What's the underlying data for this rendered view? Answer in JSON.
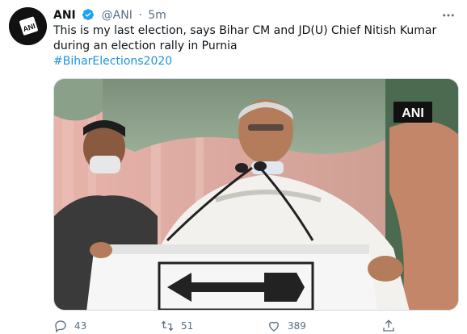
{
  "tweet": {
    "author_name": "ANI",
    "handle": "@ANI",
    "separator": "·",
    "time": "5m",
    "text": "This is my last election, says Bihar CM and JD(U) Chief Nitish Kumar during an election rally in Purnia",
    "hashtag": "#BiharElections2020",
    "media_watermark": "ANI"
  },
  "actions": {
    "reply_count": "43",
    "retweet_count": "51",
    "like_count": "389"
  },
  "colors": {
    "link": "#1b95e0",
    "verified": "#1da1f2",
    "muted": "#5b7083"
  }
}
